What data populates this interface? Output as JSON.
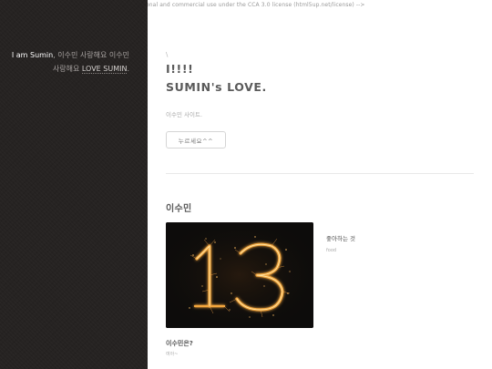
{
  "top_comment": "onal and commercial use under the CCA 3.0 license (html5up.net/license) -->",
  "sidebar": {
    "intro_strong": "I am Sumin",
    "intro_text": ", 이수민 사랑해요 이수민 사랑해요 ",
    "intro_link": "LOVE SUMIN",
    "intro_end": "."
  },
  "hero": {
    "slash": "\\",
    "title": "I!!!!\nSUMIN's LOVE.",
    "subtitle": "이수민 사이트.",
    "button_label": "누르세요^^"
  },
  "section": {
    "title": "이수민",
    "image_name": "sparkler-13-image",
    "like_title": "좋아하는 것",
    "like_sub": "food",
    "about_title": "이수민은?",
    "about_sub": "여아~"
  },
  "colors": {
    "sidebar_bg": "#262322",
    "sparkle": "#f0a040"
  }
}
